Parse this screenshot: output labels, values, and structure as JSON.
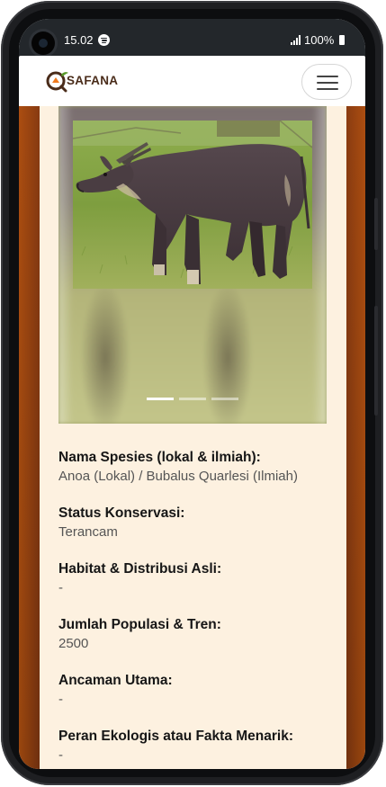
{
  "status_bar": {
    "time": "15.02",
    "battery": "100%",
    "icons": [
      "spotify-icon",
      "signal-icon",
      "battery-icon"
    ]
  },
  "navbar": {
    "logo_text": "SAFANA",
    "menu_icon": "hamburger-icon"
  },
  "carousel": {
    "image": "Anoa standing on grass",
    "indicators": [
      {
        "active": true
      },
      {
        "active": false
      },
      {
        "active": false
      }
    ]
  },
  "details": [
    {
      "label": "Nama Spesies (lokal & ilmiah):",
      "value": "Anoa (Lokal) / Bubalus Quarlesi (Ilmiah)"
    },
    {
      "label": "Status Konservasi:",
      "value": "Terancam"
    },
    {
      "label": "Habitat & Distribusi Asli:",
      "value": "-"
    },
    {
      "label": "Jumlah Populasi & Tren:",
      "value": "2500"
    },
    {
      "label": "Ancaman Utama:",
      "value": "-"
    },
    {
      "label": "Peran Ekologis atau Fakta Menarik:",
      "value": "-"
    }
  ],
  "colors": {
    "brand_brown": "#4a2c1a",
    "brand_orange": "#f07a1e",
    "card_bg": "#fdf1e0",
    "page_bg": "#6a2d12"
  }
}
